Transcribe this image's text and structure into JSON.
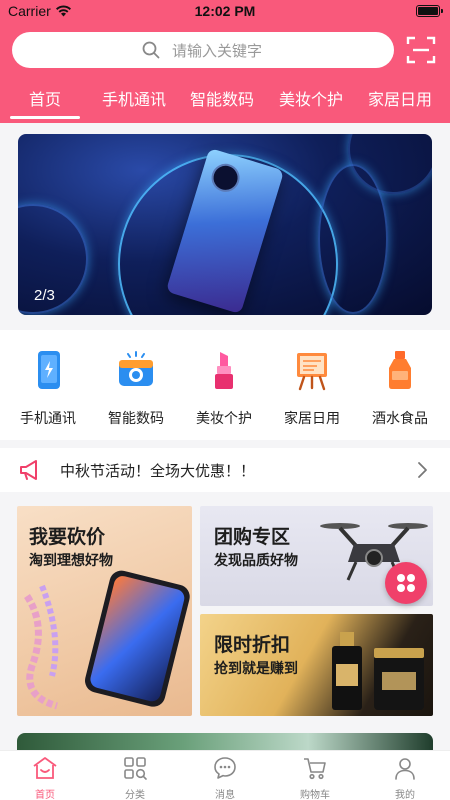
{
  "status_bar": {
    "carrier": "Carrier",
    "time": "12:02 PM"
  },
  "search": {
    "placeholder": "请输入关键字"
  },
  "tabs": [
    {
      "label": "首页",
      "active": true
    },
    {
      "label": "手机通讯"
    },
    {
      "label": "智能数码"
    },
    {
      "label": "美妆个护"
    },
    {
      "label": "家居日用"
    }
  ],
  "banner": {
    "counter": "2/3"
  },
  "categories": [
    {
      "label": "手机通讯",
      "icon": "phone-icon"
    },
    {
      "label": "智能数码",
      "icon": "camera-icon"
    },
    {
      "label": "美妆个护",
      "icon": "lipstick-icon"
    },
    {
      "label": "家居日用",
      "icon": "easel-icon"
    },
    {
      "label": "酒水食品",
      "icon": "bottle-icon"
    }
  ],
  "notice": {
    "text": "中秋节活动！全场大优惠！！"
  },
  "promos": {
    "bargain": {
      "title": "我要砍价",
      "subtitle": "淘到理想好物"
    },
    "group": {
      "title": "团购专区",
      "subtitle": "发现品质好物"
    },
    "flash": {
      "title": "限时折扣",
      "subtitle": "抢到就是赚到"
    }
  },
  "tabbar": [
    {
      "label": "首页",
      "icon": "home-icon",
      "active": true
    },
    {
      "label": "分类",
      "icon": "category-icon"
    },
    {
      "label": "消息",
      "icon": "message-icon"
    },
    {
      "label": "购物车",
      "icon": "cart-icon"
    },
    {
      "label": "我的",
      "icon": "profile-icon"
    }
  ],
  "colors": {
    "brand": "#f9597b",
    "fab": "#f0406a"
  }
}
